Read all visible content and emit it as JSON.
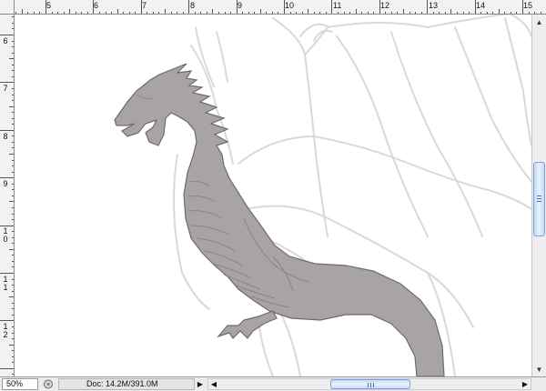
{
  "ruler_top": {
    "labels": [
      "5",
      "6",
      "7",
      "8",
      "9",
      "10",
      "11",
      "12",
      "13",
      "14",
      "15"
    ]
  },
  "ruler_left": {
    "labels": [
      "6",
      "7",
      "8",
      "9",
      "10",
      "11",
      "12"
    ]
  },
  "canvas": {
    "description_icon": "dragon-artwork",
    "dragon_fill": "#a8a3a5",
    "dragon_stroke": "#6e6a6c",
    "sketch_color": "#d9d9d9"
  },
  "statusbar": {
    "zoom": "50%",
    "doc_info": "Doc: 14.2M/391.0M",
    "menu_arrow": "▶"
  },
  "scrollbars": {
    "vertical_up": "▲",
    "vertical_down": "▼",
    "horizontal_left": "◀",
    "horizontal_right": "▶"
  }
}
